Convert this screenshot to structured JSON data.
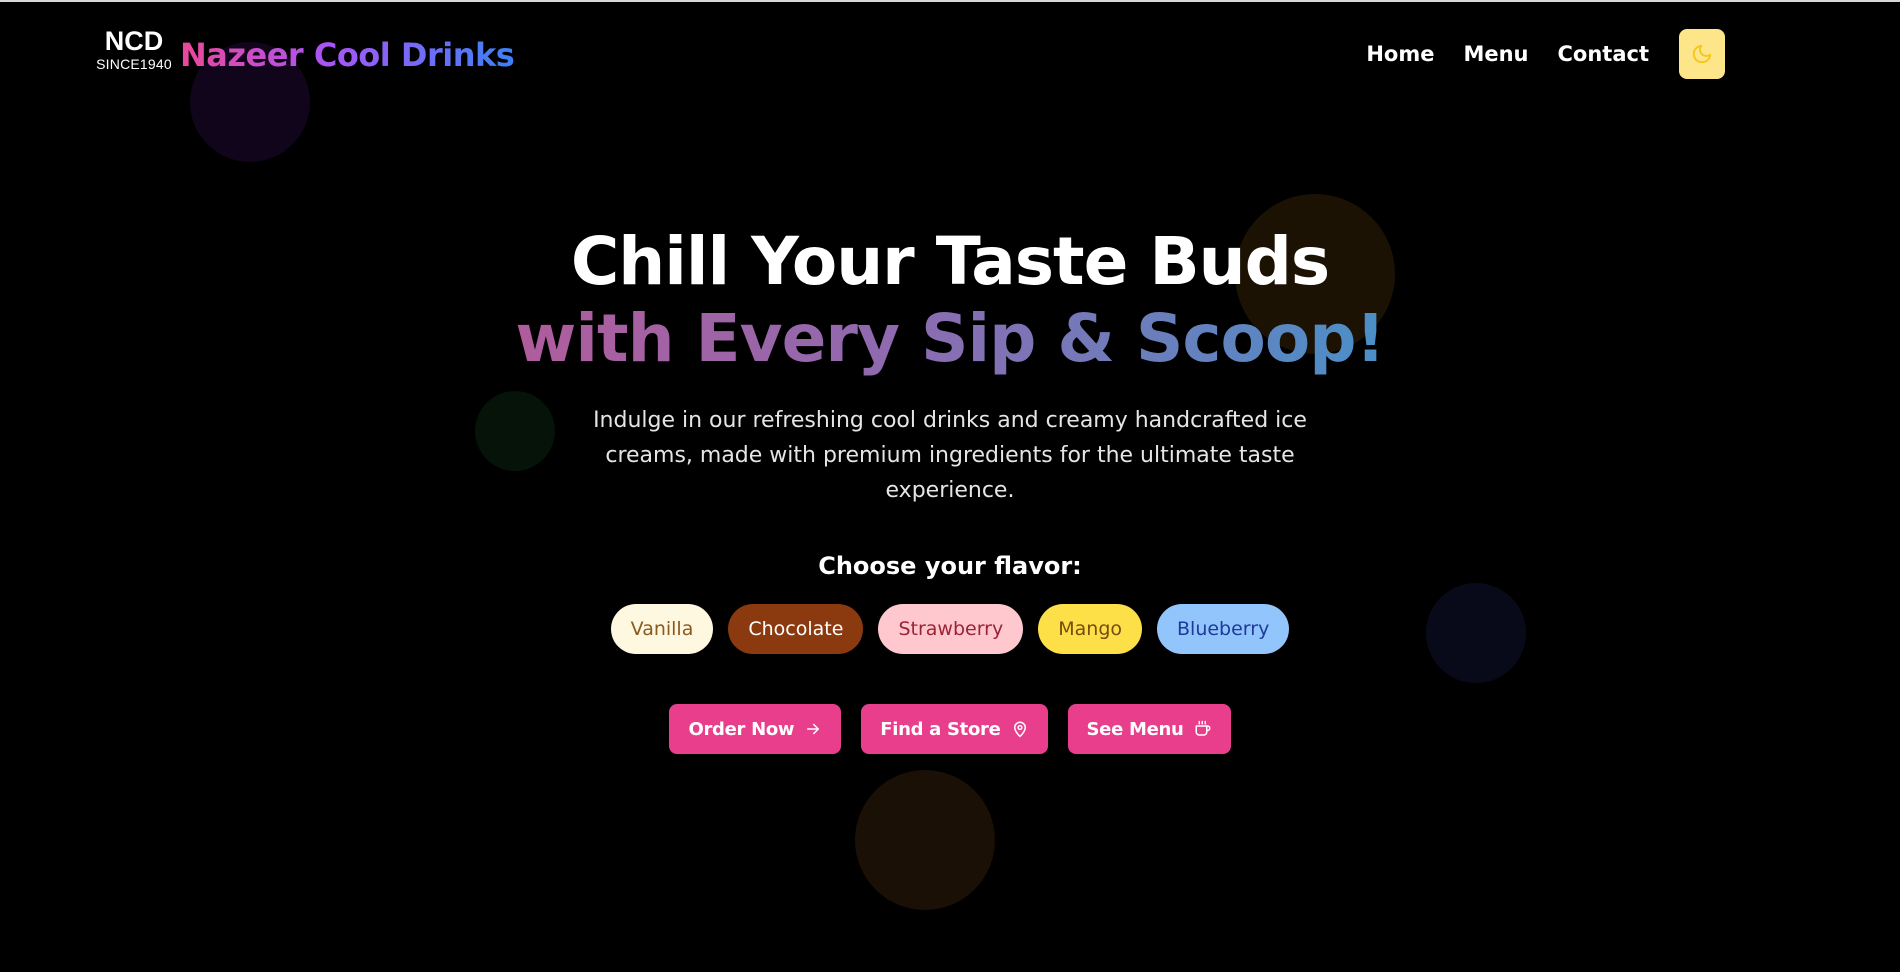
{
  "header": {
    "logo_short": "NCD",
    "logo_since": "SINCE1940",
    "brand": "Nazeer Cool Drinks",
    "nav": [
      "Home",
      "Menu",
      "Contact"
    ],
    "theme_icon": "moon-icon"
  },
  "hero": {
    "title_line1": "Chill Your Taste Buds",
    "title_line2": "with Every Sip & Scoop!",
    "subtitle": "Indulge in our refreshing cool drinks and creamy handcrafted ice creams, made with premium ingredients for the ultimate taste experience.",
    "flavor_label": "Choose your flavor:",
    "flavors": [
      {
        "label": "Vanilla",
        "bg": "#fff8e1",
        "fg": "#8a5a1e"
      },
      {
        "label": "Chocolate",
        "bg": "#8b3a0f",
        "fg": "#ffffff"
      },
      {
        "label": "Strawberry",
        "bg": "#ffc8cf",
        "fg": "#9b2335"
      },
      {
        "label": "Mango",
        "bg": "#fde047",
        "fg": "#7a4a10"
      },
      {
        "label": "Blueberry",
        "bg": "#93c5fd",
        "fg": "#1e3a9a"
      }
    ],
    "actions": [
      {
        "label": "Order Now",
        "icon": "arrow-right-icon"
      },
      {
        "label": "Find a Store",
        "icon": "map-pin-icon"
      },
      {
        "label": "See Menu",
        "icon": "coffee-cup-icon"
      }
    ]
  },
  "colors": {
    "accent": "#e83e8c",
    "toggle_bg": "#fde68a",
    "background": "#000000"
  }
}
